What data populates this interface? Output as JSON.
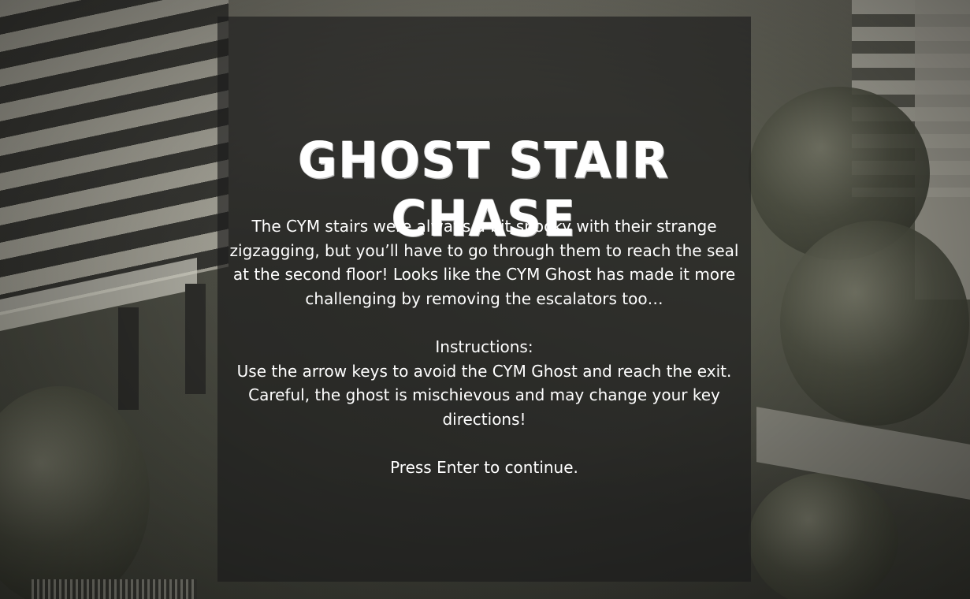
{
  "game": {
    "title": "GHOST STAIR CHASE",
    "intro": "The CYM stairs were always a bit spooky with their strange zigzagging, but you’ll have to go through them to reach the seal at the second floor! Looks like the CYM Ghost has made it more challenging by removing the escalators too…",
    "instructions_heading": "Instructions:",
    "instructions_text": "Use the arrow keys to avoid the CYM Ghost and reach the exit. Careful, the ghost is mischievous and may change your key directions!",
    "continue_prompt": "Press Enter to continue."
  },
  "colors": {
    "panel_overlay": "rgba(28,28,28,0.66)",
    "text": "#ffffff"
  }
}
